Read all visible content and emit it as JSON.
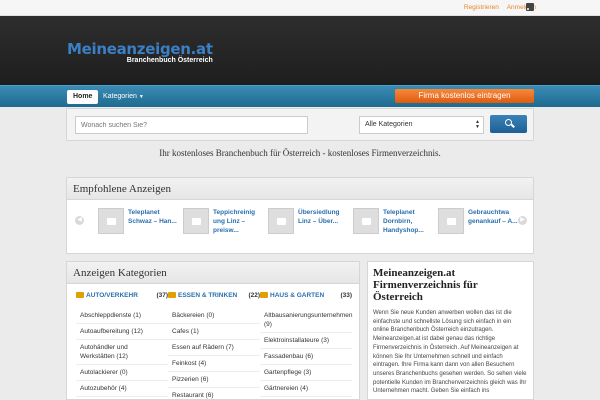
{
  "topbar": {
    "register": "Registrieren",
    "login": "Anmelden",
    "rss_icon": "rss-icon"
  },
  "header": {
    "logo_main": "Meineanzeigen.at",
    "logo_sub": "Branchenbuch Österreich"
  },
  "nav": {
    "home": "Home",
    "kategorien": "Kategorien",
    "cta": "Firma kostenlos eintragen"
  },
  "search": {
    "placeholder": "Wonach suchen Sie?",
    "category_selected": "Alle Kategorien",
    "button_icon": "search-icon"
  },
  "tagline": "Ihr kostenloses Branchenbuch für Österreich - kostenloses Firmenverzeichnis.",
  "featured": {
    "title": "Empfohlene Anzeigen",
    "items": [
      {
        "title": "Teleplanet Schwaz – Han..."
      },
      {
        "title": "Teppichreinig ung Linz – preisw..."
      },
      {
        "title": "Übersiedlung Linz – Über..."
      },
      {
        "title": "Teleplanet Dornbirn, Handyshop..."
      },
      {
        "title": "Gebrauchtwa genankauf – A..."
      }
    ]
  },
  "categories": {
    "title": "Anzeigen Kategorien",
    "columns": [
      {
        "name": "AUTO/VERKEHR",
        "count": "(37)",
        "items": [
          "Abschleppdienste (1)",
          "Autoaufbereitung (12)",
          "Autohändler und Werkstätten (12)",
          "Autolackierer (0)",
          "Autozubehör (4)"
        ]
      },
      {
        "name": "ESSEN & TRINKEN",
        "count": "(22)",
        "items": [
          "Bäckereien (0)",
          "Cafes (1)",
          "Essen auf Rädern (7)",
          "Feinkost (4)",
          "Pizzerien (6)",
          "Restaurant (6)"
        ]
      },
      {
        "name": "HAUS & GARTEN",
        "count": "(33)",
        "items": [
          "Altbausanierungsunternehmen (9)",
          "Elektroinstallateure (3)",
          "Fassadenbau (6)",
          "Gartenpflege (3)",
          "Gärtnereien (4)"
        ]
      }
    ]
  },
  "about": {
    "title": "Meineanzeigen.at Firmenverzeichnis für Österreich",
    "text": "Wenn Sie neue Kunden anwerben wollen das ist die einfachste und schnellste Lösung sich einfach in ein online Branchenbuch Österreich einzutragen. Meineanzeigen.at ist dabei genau das richtige Firmenverzeichnis in Österreich. Auf Meineanzeigen at können Sie Ihr Unternehmen schnell und einfach eintragen. Ihre Firma kann dann von allen Besuchern unseres Branchenbuchs gesehen werden. So sehen viele potentielle Kunden im Branchenverzeichnis gleich was Ihr Unternehmen macht. Geben Sie einfach ins"
  }
}
